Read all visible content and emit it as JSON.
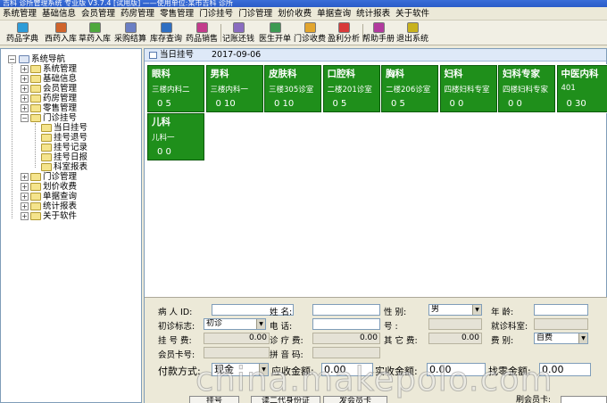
{
  "window": {
    "title": "吉科 诊所管理系统 专业版 V3.7.4 [试用版] ——使用单位:某市吉科 诊所"
  },
  "menu": [
    "系统管理",
    "基础信息",
    "会员管理",
    "药房管理",
    "零售管理",
    "门诊挂号",
    "门诊管理",
    "划价收费",
    "单据查询",
    "统计报表",
    "关于软件"
  ],
  "toolbar": [
    {
      "label": "药品字典",
      "icon": "pill-icon",
      "color": "#2e9cd8"
    },
    {
      "label": "西药入库",
      "icon": "package-in-icon",
      "color": "#d0642c"
    },
    {
      "label": "草药入库",
      "icon": "herb-icon",
      "color": "#4fa83d"
    },
    {
      "label": "采购结算",
      "icon": "settle-icon",
      "color": "#6b7fc4"
    },
    {
      "label": "库存查询",
      "icon": "stock-query-icon",
      "color": "#2f6fc2"
    },
    {
      "label": "药品销售",
      "icon": "sales-icon",
      "color": "#c33c8c"
    },
    {
      "label": "记账还钱",
      "icon": "ledger-icon",
      "color": "#8a6cc0"
    },
    {
      "label": "医生开单",
      "icon": "doctor-order-icon",
      "color": "#3d9a52"
    },
    {
      "label": "门诊收费",
      "icon": "cashier-icon",
      "color": "#e2a52e"
    },
    {
      "label": "盈利分析",
      "icon": "chart-icon",
      "color": "#d83a3a"
    },
    {
      "label": "帮助手册",
      "icon": "help-book-icon",
      "color": "#b23a9e"
    },
    {
      "label": "退出系统",
      "icon": "exit-icon",
      "color": "#c8b21e"
    }
  ],
  "nav": {
    "root": "系统导航",
    "items": [
      "系统管理",
      "基础信息",
      "会员管理",
      "药房管理",
      "零售管理",
      "门诊挂号",
      "门诊管理",
      "划价收费",
      "单据查询",
      "统计报表",
      "关于软件"
    ],
    "open_children": [
      "当日挂号",
      "挂号退号",
      "挂号记录",
      "挂号日报",
      "科室报表"
    ]
  },
  "tab": {
    "label": "当日挂号",
    "date": "2017-09-06"
  },
  "departments": [
    {
      "name": "眼科",
      "location": "三楼内科二",
      "count": "0  5"
    },
    {
      "name": "男科",
      "location": "三楼内科一",
      "count": "0  10"
    },
    {
      "name": "皮肤科",
      "location": "三楼305诊室",
      "count": "0  10"
    },
    {
      "name": "口腔科",
      "location": "二楼201诊室",
      "count": "0  5"
    },
    {
      "name": "胸科",
      "location": "二楼206诊室",
      "count": "0  5"
    },
    {
      "name": "妇科",
      "location": "四楼妇科专室",
      "count": "0  0"
    },
    {
      "name": "妇科专家",
      "location": "四楼妇科专家",
      "count": "0  0"
    },
    {
      "name": "中医内科",
      "location": "401",
      "count": "0  30"
    },
    {
      "name": "儿科",
      "location": "儿科一",
      "count": "0  0"
    }
  ],
  "form": {
    "patient_id_label": "病 人 ID:",
    "name_label": "姓    名:",
    "gender_label": "性    别:",
    "gender_value": "男",
    "age_label": "年    龄:",
    "visit_flag_label": "初诊标志:",
    "visit_flag_value": "初诊",
    "phone_label": "电    话:",
    "number_label": "号    :",
    "room_label": "就诊科室:",
    "reg_fee_label": "挂 号 费:",
    "reg_fee_value": "0.00",
    "consult_fee_label": "诊 疗 费:",
    "consult_fee_value": "0.00",
    "other_fee_label": "其 它 费:",
    "other_fee_value": "0.00",
    "fee_type_label": "费    别:",
    "fee_type_value": "自费",
    "member_card_label": "会员卡号:",
    "pinyin_label": "拼 音 码:"
  },
  "payment": {
    "method_label": "付款方式:",
    "method_value": "现金",
    "due_label": "应收金额:",
    "due_value": "0.00",
    "paid_label": "实收金额:",
    "paid_value": "0.00",
    "change_label": "找零金额:",
    "change_value": "0.00"
  },
  "bottom_buttons": [
    "挂号",
    "读二代身份证",
    "发会员卡",
    "刷会员卡:"
  ],
  "watermark": "china.makepolo.com"
}
